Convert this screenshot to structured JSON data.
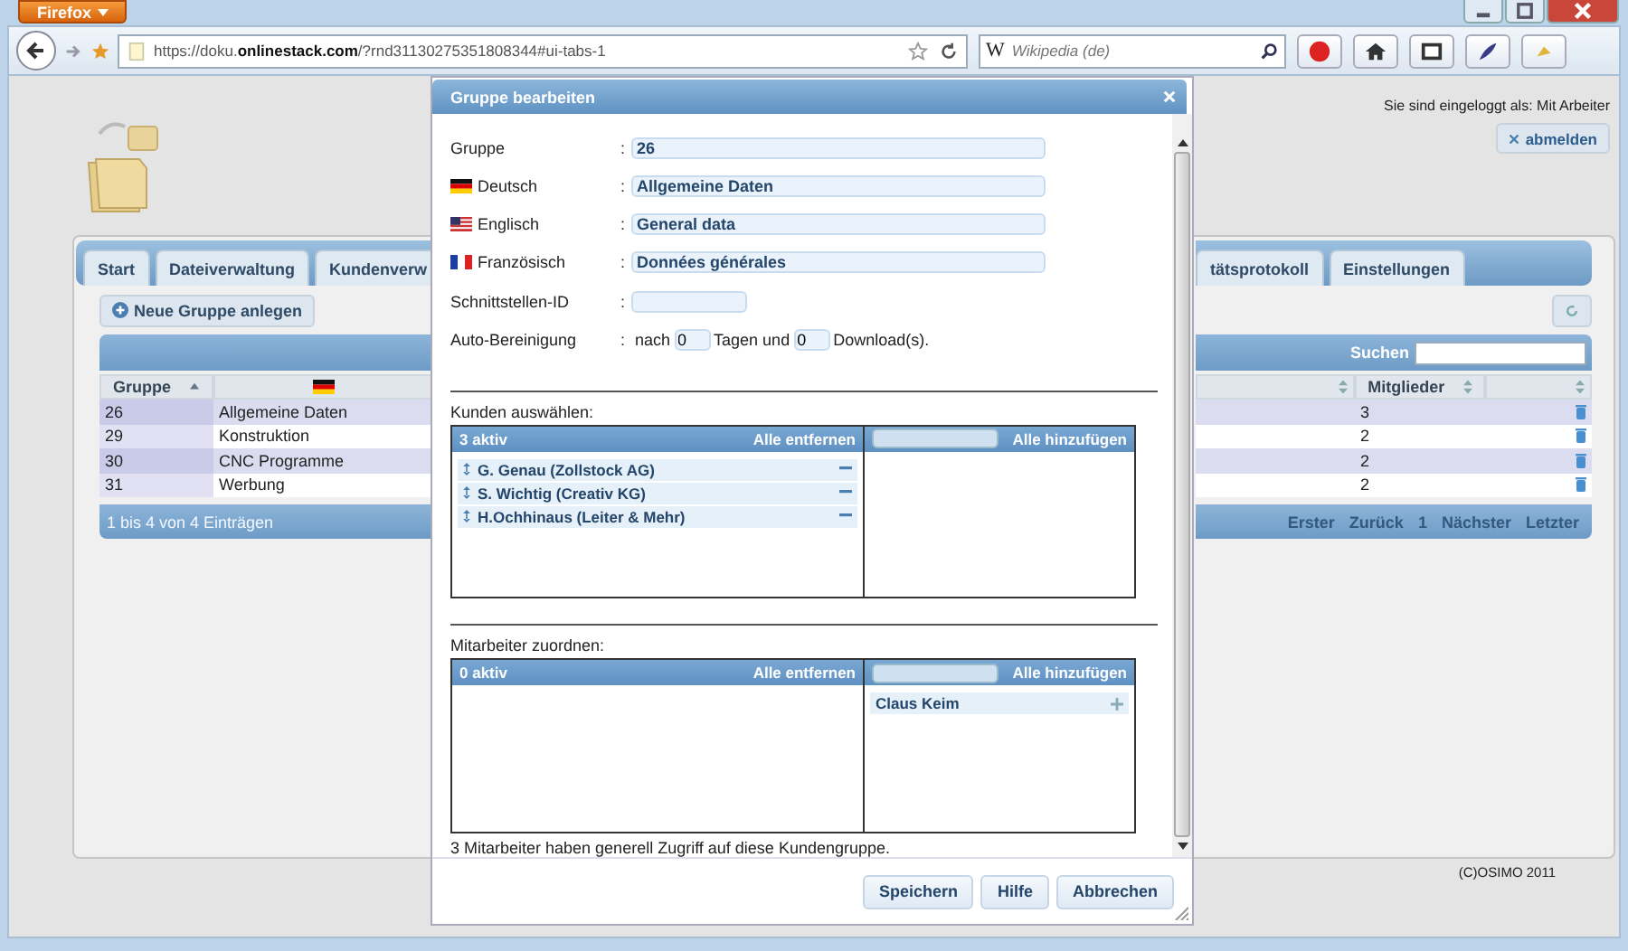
{
  "browser": {
    "menu_button": "Firefox",
    "url": "https://doku.**onlinestack.com**/?rnd31130275351808344#ui-tabs-1",
    "search_engine": "W",
    "search_placeholder": "Wikipedia (de)"
  },
  "header": {
    "login_text": "Sie sind eingeloggt als: Mit Arbeiter",
    "logout_button": "abmelden"
  },
  "tabs_left": [
    {
      "label": "Start",
      "selected": false
    },
    {
      "label": "Dateiverwaltung",
      "selected": false
    },
    {
      "label": "Kundenverw",
      "selected": false
    }
  ],
  "tabs_right": [
    {
      "label": "tätsprotokoll",
      "selected": false
    },
    {
      "label": "Einstellungen",
      "selected": false
    }
  ],
  "new_group_button": "Neue Gruppe anlegen",
  "search_label": "Suchen",
  "table": {
    "column_group": "Gruppe",
    "column_members": "Mitglieder",
    "rows": [
      {
        "group": "26",
        "name": "Allgemeine Daten",
        "members": "3"
      },
      {
        "group": "29",
        "name": "Konstruktion",
        "members": "2"
      },
      {
        "group": "30",
        "name": "CNC Programme",
        "members": "2"
      },
      {
        "group": "31",
        "name": "Werbung",
        "members": "2"
      }
    ]
  },
  "table_info": "1 bis 4 von 4 Einträgen",
  "pager": [
    {
      "label": "Erster",
      "disabled": true
    },
    {
      "label": "Zurück",
      "disabled": true
    },
    {
      "label": "1",
      "disabled": true
    },
    {
      "label": "Nächster",
      "disabled": true
    },
    {
      "label": "Letzter",
      "disabled": true
    }
  ],
  "copyright": "(C)OSIMO 2011",
  "dialog": {
    "title": "Gruppe bearbeiten",
    "fields": [
      {
        "kind": "plain",
        "label": "Gruppe",
        "separator": ":",
        "value": "26"
      },
      {
        "kind": "german",
        "label": "Deutsch",
        "separator": ":",
        "value": "Allgemeine Daten"
      },
      {
        "kind": "english",
        "label": "Englisch",
        "separator": ":",
        "value": "General data"
      },
      {
        "kind": "french",
        "label": "Französisch",
        "separator": ":",
        "value": "Données générales"
      },
      {
        "kind": "short",
        "label": "Schnittstellen-ID",
        "separator": ":"
      }
    ],
    "cleanup": {
      "label": "Auto-Bereinigung",
      "separator": ":",
      "prefix": "nach",
      "days": "0",
      "middle": "Tagen und",
      "downloads": "0",
      "suffix": "Download(s)."
    },
    "lists": [
      {
        "label": "Kunden auswählen:",
        "active_count": "3 aktiv",
        "remove_all": "Alle entfernen",
        "add_all": "Alle hinzufügen",
        "selected_items": [
          "G. Genau (Zollstock AG)",
          "S. Wichtig (Creativ KG)",
          "H.Ochhinaus (Leiter & Mehr)"
        ]
      },
      {
        "label": "Mitarbeiter zuordnen:",
        "active_count": "0 aktiv",
        "remove_all": "Alle entfernen",
        "add_all": "Alle hinzufügen",
        "available_items": [
          "Claus Keim"
        ]
      }
    ],
    "note": "3 Mitarbeiter haben generell Zugriff auf diese Kundengruppe.",
    "buttons": [
      "Speichern",
      "Hilfe",
      "Abbrechen"
    ]
  }
}
